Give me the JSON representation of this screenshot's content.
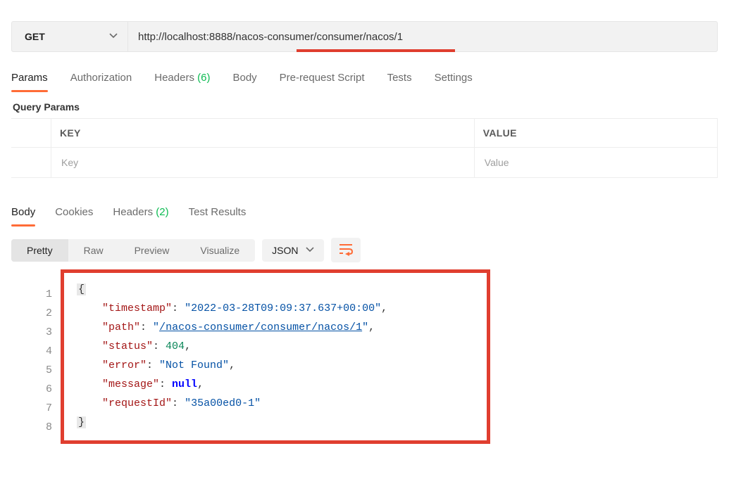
{
  "request": {
    "method": "GET",
    "url": "http://localhost:8888/nacos-consumer/consumer/nacos/1"
  },
  "tabs": {
    "params": "Params",
    "authorization": "Authorization",
    "headers": "Headers",
    "headers_count": "(6)",
    "body": "Body",
    "prerequest": "Pre-request Script",
    "tests": "Tests",
    "settings": "Settings"
  },
  "query_params": {
    "title": "Query Params",
    "header_key": "KEY",
    "header_value": "VALUE",
    "placeholder_key": "Key",
    "placeholder_value": "Value"
  },
  "response_tabs": {
    "body": "Body",
    "cookies": "Cookies",
    "headers": "Headers",
    "headers_count": "(2)",
    "test_results": "Test Results"
  },
  "viewbar": {
    "pretty": "Pretty",
    "raw": "Raw",
    "preview": "Preview",
    "visualize": "Visualize",
    "format": "JSON"
  },
  "response_body": {
    "timestamp_key": "\"timestamp\"",
    "timestamp_val": "\"2022-03-28T09:09:37.637+00:00\"",
    "path_key": "\"path\"",
    "path_val_open": "\"",
    "path_val_text": "/nacos-consumer/consumer/nacos/1",
    "path_val_close": "\"",
    "status_key": "\"status\"",
    "status_val": "404",
    "error_key": "\"error\"",
    "error_val": "\"Not Found\"",
    "message_key": "\"message\"",
    "message_val": "null",
    "requestId_key": "\"requestId\"",
    "requestId_val": "\"35a00ed0-1\""
  },
  "line_numbers": [
    "1",
    "2",
    "3",
    "4",
    "5",
    "6",
    "7",
    "8"
  ]
}
